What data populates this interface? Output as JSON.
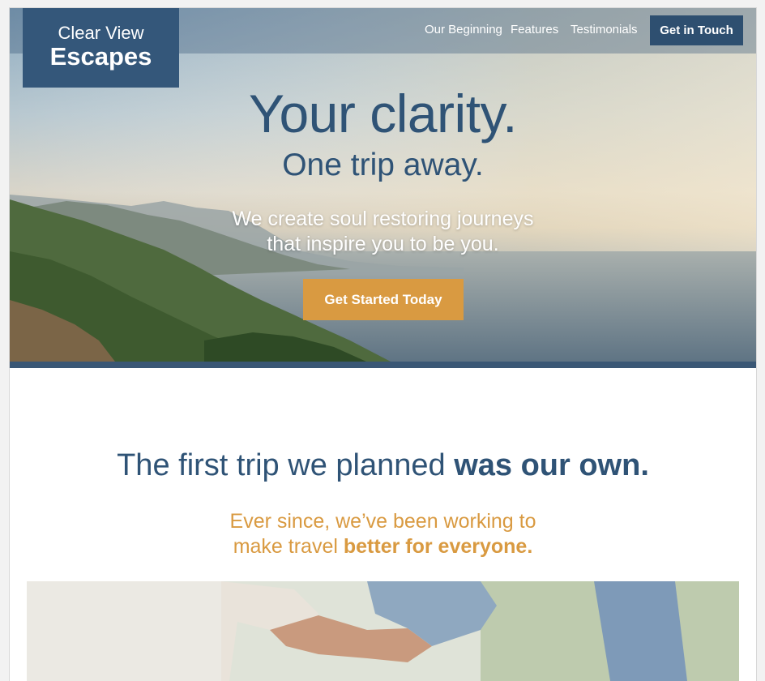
{
  "brand": {
    "logo_line1": "Clear View",
    "logo_line2": "Escapes"
  },
  "nav": {
    "items": [
      {
        "label": "Our Beginning"
      },
      {
        "label": "Features"
      },
      {
        "label": "Testimonials"
      }
    ],
    "cta_label": "Get in Touch"
  },
  "hero": {
    "title": "Your clarity.",
    "subtitle": "One trip away.",
    "description_line1": "We create soul restoring journeys",
    "description_line2": "that inspire you to be you.",
    "cta_label": "Get Started Today"
  },
  "story": {
    "title_light": "The first trip we planned ",
    "title_bold": "was our own.",
    "subtitle_line1": "Ever since, we’ve been working to",
    "subtitle_line2_light": "make travel ",
    "subtitle_line2_bold": "better for everyone."
  },
  "colors": {
    "navy": "#34577a",
    "dark_navy": "#2e4f70",
    "accent_orange": "#d99a41",
    "title_blue": "#2f5376"
  }
}
